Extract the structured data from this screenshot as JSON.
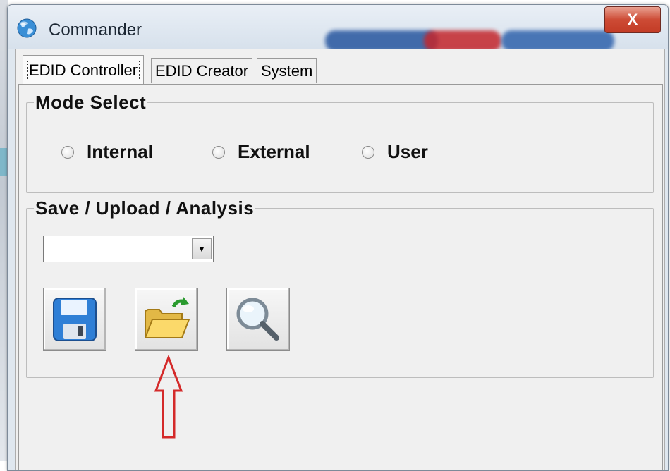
{
  "window": {
    "title": "Commander",
    "close_label": "X"
  },
  "tabs": [
    {
      "label": "EDID Controller",
      "active": true
    },
    {
      "label": "EDID Creator",
      "active": false
    },
    {
      "label": "System",
      "active": false
    }
  ],
  "mode_select": {
    "legend": "Mode Select",
    "options": [
      {
        "label": "Internal",
        "selected": false
      },
      {
        "label": "External",
        "selected": false
      },
      {
        "label": "User",
        "selected": false
      }
    ]
  },
  "save_upload": {
    "legend": "Save / Upload / Analysis",
    "dropdown_value": "",
    "buttons": [
      "save-icon",
      "open-folder-icon",
      "magnifier-icon"
    ]
  },
  "annotation": {
    "icon": "red-up-arrow",
    "color": "#d42a2a"
  },
  "colors": {
    "client_bg": "#f0f0f0",
    "close_button": "#c33c26"
  }
}
